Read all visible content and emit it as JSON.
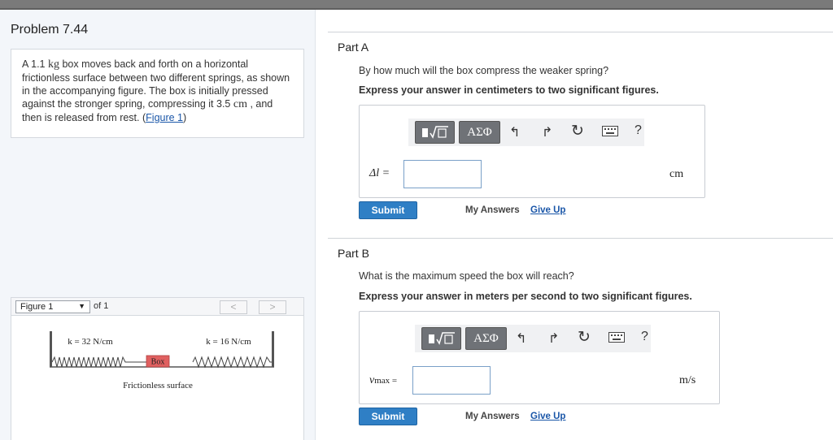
{
  "problem": {
    "title": "Problem 7.44",
    "text_a": "A 1.1 ",
    "unit_kg": "kg",
    "text_b": " box moves back and forth on a horizontal frictionless surface between two different springs, as shown in the accompanying figure. The box is initially pressed against the stronger spring, compressing it 3.5 ",
    "unit_cm": "cm",
    "text_c": " , and then is released from rest. (",
    "figure_link": "Figure 1",
    "text_d": ")"
  },
  "figure": {
    "select_label": "Figure 1",
    "of_label": "of 1",
    "prev": "<",
    "next": ">",
    "k_left": "k = 32 N/cm",
    "k_right": "k = 16 N/cm",
    "box_label": "Box",
    "surface_label": "Frictionless surface"
  },
  "parts": [
    {
      "title": "Part A",
      "question": "By how much will the box compress the weaker spring?",
      "instruction": "Express your answer in centimeters to two significant figures.",
      "answer_label": "Δl =",
      "answer_value": "",
      "unit": "cm",
      "submit": "Submit",
      "my_answers": "My Answers",
      "give_up": "Give Up"
    },
    {
      "title": "Part B",
      "question": "What is the maximum speed the box will reach?",
      "instruction": "Express your answer in meters per second to two significant figures.",
      "answer_label_main": "v",
      "answer_label_sub": "max",
      "answer_label_eq": " =",
      "answer_value": "",
      "unit": "m/s",
      "submit": "Submit",
      "my_answers": "My Answers",
      "give_up": "Give Up"
    }
  ],
  "toolbar": {
    "greek_label": "ΑΣΦ",
    "help_label": "?",
    "icons": [
      "templates-icon",
      "greek-symbols-icon",
      "undo-icon",
      "redo-icon",
      "reset-icon",
      "keyboard-icon",
      "help-icon"
    ]
  },
  "colors": {
    "submit": "#2f7fc5",
    "link": "#1a56a8",
    "box_fill": "#e06060"
  }
}
